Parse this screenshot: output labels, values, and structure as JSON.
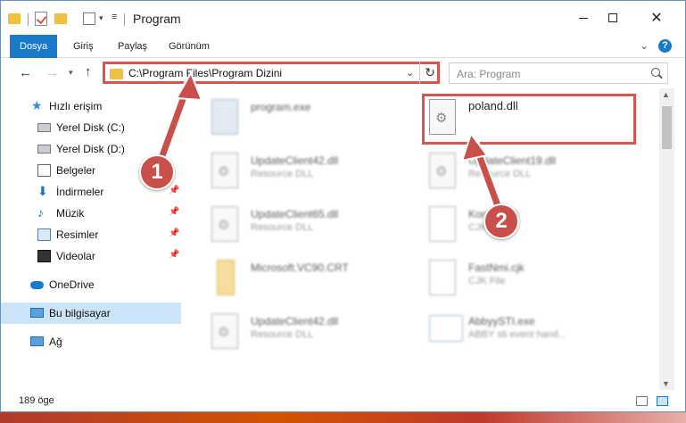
{
  "window": {
    "title": "Program"
  },
  "ribbon": {
    "tabs": [
      "Dosya",
      "Giriş",
      "Paylaş",
      "Görünüm"
    ],
    "help": "?"
  },
  "address": {
    "path": "C:\\Program Files\\Program Dizini"
  },
  "search": {
    "placeholder": "Ara: Program"
  },
  "sidebar": {
    "items": [
      {
        "label": "Hızlı erişim",
        "icon": "star-icon"
      },
      {
        "label": "Yerel Disk (C:)",
        "icon": "drive-icon"
      },
      {
        "label": "Yerel Disk (D:)",
        "icon": "drive-icon"
      },
      {
        "label": "Belgeler",
        "icon": "document-icon"
      },
      {
        "label": "İndirmeler",
        "icon": "download-icon"
      },
      {
        "label": "Müzik",
        "icon": "music-icon"
      },
      {
        "label": "Resimler",
        "icon": "pictures-icon"
      },
      {
        "label": "Videolar",
        "icon": "video-icon"
      },
      {
        "label": "OneDrive",
        "icon": "cloud-icon"
      },
      {
        "label": "Bu bilgisayar",
        "icon": "computer-icon"
      },
      {
        "label": "Ağ",
        "icon": "network-icon"
      }
    ],
    "selected": "Bu bilgisayar"
  },
  "files": [
    {
      "name": "program.exe",
      "type": ""
    },
    {
      "name": "poland.dll",
      "type": ""
    },
    {
      "name": "UpdateClient42.dll",
      "type": "Resource DLL"
    },
    {
      "name": "UpdateClient19.dll",
      "type": "Resource DLL"
    },
    {
      "name": "UpdateClient65.dll",
      "type": "Resource DLL"
    },
    {
      "name": "Korean.cjk",
      "type": "CJK File"
    },
    {
      "name": "Microsoft.VC90.CRT",
      "type": ""
    },
    {
      "name": "FastNmi.cjk",
      "type": "CJK File"
    },
    {
      "name": "UpdateClient42.dll",
      "type": "Resource DLL"
    },
    {
      "name": "AbbyySTI.exe",
      "type": "ABBY sti event hand..."
    }
  ],
  "status": {
    "count": "189 öge"
  },
  "annotations": {
    "badge1": "1",
    "badge2": "2"
  },
  "colors": {
    "accent": "#1979ca",
    "highlight": "#d9534f",
    "badge": "#c94f4a"
  }
}
